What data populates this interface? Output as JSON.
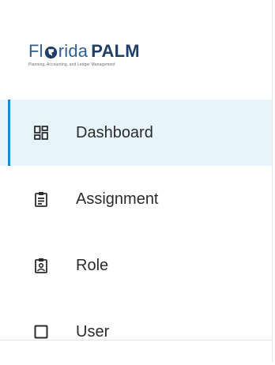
{
  "logo": {
    "part1": "Fl",
    "part2": "rida",
    "part3": "PALM",
    "tagline": "Planning, Accounting, and Ledger Management"
  },
  "menu": {
    "items": [
      {
        "label": "Dashboard",
        "icon": "dashboard-icon",
        "active": true
      },
      {
        "label": "Assignment",
        "icon": "clipboard-icon",
        "active": false
      },
      {
        "label": "Role",
        "icon": "badge-icon",
        "active": false
      },
      {
        "label": "User",
        "icon": "square-icon",
        "active": false
      }
    ]
  },
  "colors": {
    "accent": "#1b8ad6",
    "active_bg": "#e8f4fb",
    "logo_blue": "#2f5f8f",
    "logo_navy": "#1f3f66",
    "text": "#2b2b2b"
  }
}
